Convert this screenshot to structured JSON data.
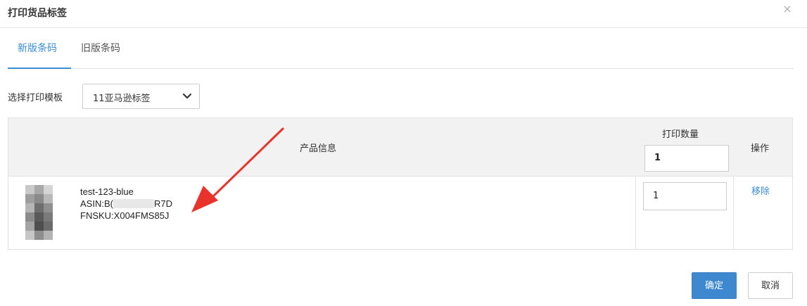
{
  "dialog": {
    "title": "打印货品标签",
    "close_icon": "×"
  },
  "tabs": [
    {
      "label": "新版条码",
      "active": true
    },
    {
      "label": "旧版条码",
      "active": false
    }
  ],
  "template": {
    "label": "选择打印模板",
    "selected": "11亚马逊标签"
  },
  "table": {
    "headers": {
      "product": "产品信息",
      "quantity": "打印数量",
      "action": "操作"
    },
    "bulk_quantity": "1",
    "rows": [
      {
        "name": "test-123-blue",
        "asin_prefix": "ASIN:B(",
        "asin_suffix": "R7D",
        "fnsku": "FNSKU:X004FMS85J",
        "quantity": "1",
        "action": "移除"
      }
    ]
  },
  "buttons": {
    "confirm": "确定",
    "cancel": "取消"
  },
  "colors": {
    "accent": "#3b8dd6",
    "primary_button": "#3e88cf",
    "annotation_arrow": "#e8322b"
  }
}
